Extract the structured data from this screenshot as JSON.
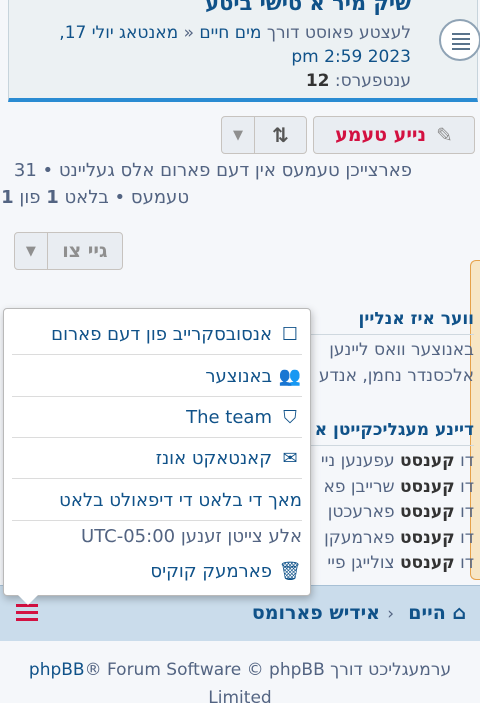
{
  "topic": {
    "title": "שיק מיר א טישי ביטע",
    "meta_prefix": "לעצטע פאוסט דורך",
    "meta_user": "מים חיים",
    "meta_sep": "«",
    "meta_date": "מאנטאג יולי 17, 2023 2:59 pm",
    "replies_label": "ענטפערס:",
    "replies_count": "12"
  },
  "toolbar": {
    "reply_label": "נייע טעמע",
    "reply_icon": "pencil-icon",
    "sort_icon": "sort-icon",
    "caret_icon": "caret-down-icon"
  },
  "stats": {
    "line1": "פארצייכן טעמעס אין דעם פארום אלס געליינט • 31",
    "line2_prefix": "טעמעס • בלאט",
    "page_current": "1",
    "page_sep": "פון",
    "page_total": "1"
  },
  "goto": {
    "label": "גיי צו"
  },
  "background": {
    "online_title": "ווער איז אנליין",
    "online_line1": "באנוצער וואס ליינען",
    "online_line2": "אלכסנדר נחמן, אנדע",
    "perm_title": "דיינע מעגליכקייטן א",
    "perm_rows": [
      {
        "prefix": "דו",
        "bold": "קענסט",
        "rest": "עפענען ניי"
      },
      {
        "prefix": "דו",
        "bold": "קענסט",
        "rest": "שרייבן פא"
      },
      {
        "prefix": "דו",
        "bold": "קענסט",
        "rest": "פארעכטן"
      },
      {
        "prefix": "דו",
        "bold": "קענסט",
        "rest": "פארמעקן"
      },
      {
        "prefix": "דו",
        "bold": "קענסט",
        "rest": "צולייגן פיי"
      }
    ]
  },
  "dropdown": {
    "items": [
      {
        "label": "אנסובסקרייב פון דעם פארום",
        "icon": "checkbox-icon"
      },
      {
        "label": "באנוצער",
        "icon": "users-icon"
      },
      {
        "label": "The team",
        "icon": "shield-icon"
      },
      {
        "label": "קאנטאקט אונז",
        "icon": "envelope-icon"
      },
      {
        "label": "מאך די בלאט די דיפאולט בלאט",
        "icon": ""
      }
    ],
    "timezone": "אלע צייטן זענען UTC-05:00",
    "delete_cookies": "פארמעק קוקיס",
    "delete_icon": "trash-icon"
  },
  "navbar": {
    "home": "הייםhome",
    "home_label": "היים",
    "sep": "‹",
    "forum": "אידיש פארומס",
    "menu_icon": "hamburger-icon"
  },
  "footer": {
    "prefix": "ערמעגליכט דורך",
    "link": "phpBB",
    "suffix": "® Forum Software © phpBB",
    "limited": "Limited"
  },
  "colors": {
    "link": "#105289",
    "accent": "#d31141",
    "bar": "#2a8bd2"
  }
}
